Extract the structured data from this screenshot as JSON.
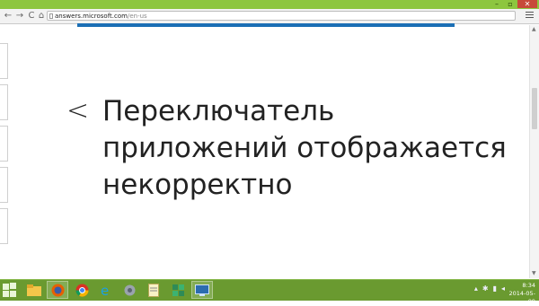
{
  "browser": {
    "url_domain": "answers.microsoft.com",
    "url_path": "/en-us",
    "nav": {
      "back": "←",
      "forward": "→",
      "reload": "C",
      "home": "⌂"
    },
    "window_controls": {
      "minimize": "–",
      "maximize": "▫",
      "close": "✕"
    }
  },
  "page": {
    "back_symbol": "<",
    "headline": "Переключатель приложений отображается некорректно"
  },
  "taskbar": {
    "apps": [
      "file-explorer-icon",
      "firefox-icon",
      "chrome-icon",
      "internet-explorer-icon",
      "tools-icon",
      "notepad-icon",
      "puzzle-icon",
      "remote-desktop-icon"
    ],
    "clock": {
      "time": "8:34",
      "date": "2014-05-09"
    }
  },
  "colors": {
    "titlebar": "#8dc63f",
    "notice": "#1c6fb5",
    "taskbar": "#6a9a30",
    "text": "#222222"
  }
}
